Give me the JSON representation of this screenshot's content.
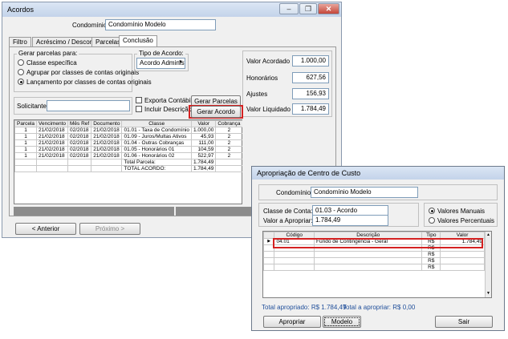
{
  "acordos": {
    "title": "Acordos",
    "condominio_label": "Condomínio:",
    "condominio_value": "Condomínio Modelo",
    "tabs": [
      "Filtro",
      "Acréscimo / Desconto",
      "Parcelas",
      "Conclusão"
    ],
    "gerar_group_title": "Gerar parcelas para:",
    "radio_options": [
      "Classe específica",
      "Agrupar por classes de contas originais",
      "Lançamento por classes de contas originais"
    ],
    "selected_radio": 2,
    "tipo_group_title": "Tipo de Acordo:",
    "tipo_value": "Acordo Administ",
    "valor_acordado_label": "Valor Acordado",
    "valor_acordado": "1.000,00",
    "honorarios_label": "Honorários",
    "honorarios": "627,56",
    "ajustes_label": "Ajustes",
    "ajustes": "156,93",
    "valor_liquido_label": "Valor Liquidado",
    "valor_liquido": "1.784,49",
    "solicitante_label": "Solicitante:",
    "exporta_label": "Exporta Contábil",
    "incluir_label": "Incluir Descrição",
    "gerar_parcelas_btn": "Gerar Parcelas",
    "gerar_acordo_btn": "Gerar Acordo",
    "table": {
      "headers": [
        "Parcela",
        "Vencimento",
        "Mês Ref",
        "Documento",
        "Classe",
        "Valor",
        "Cobrança"
      ],
      "rows": [
        [
          "1",
          "21/02/2018",
          "02/2018",
          "21/02/2018",
          "01.01 - Taxa de Condomínio",
          "1.000,00",
          "2"
        ],
        [
          "1",
          "21/02/2018",
          "02/2018",
          "21/02/2018",
          "01.09 - Juros/Multas Ativos",
          "45,93",
          "2"
        ],
        [
          "1",
          "21/02/2018",
          "02/2018",
          "21/02/2018",
          "01.04 - Outras Cobranças",
          "111,00",
          "2"
        ],
        [
          "1",
          "21/02/2018",
          "02/2018",
          "21/02/2018",
          "01.05 - Honorários 01",
          "104,59",
          "2"
        ],
        [
          "1",
          "21/02/2018",
          "02/2018",
          "21/02/2018",
          "01.06 - Honorários 02",
          "522,97",
          "2"
        ]
      ],
      "total_parcela_label": "Total Parcela:",
      "total_parcela": "1.784,49",
      "total_acordo_label": "TOTAL ACORDO:",
      "total_acordo": "1.784,49"
    },
    "anterior_btn": "< Anterior",
    "proximo_btn": "Próximo >"
  },
  "apropriacao": {
    "title": "Apropriação de Centro de Custo",
    "condominio_label": "Condomínio:",
    "condominio_value": "Condomínio Modelo",
    "classe_label": "Classe de Conta:",
    "classe_value": "01.03 - Acordo",
    "valor_label": "Valor a Apropriar:",
    "valor_value": "1.784,49",
    "radio_manual": "Valores Manuais",
    "radio_percent": "Valores Percentuais",
    "grid_headers": [
      "Código",
      "Descrição",
      "Tipo",
      "Valor"
    ],
    "grid_row": [
      "04.01",
      "Fundo de Contingência - Geral",
      "R$",
      "1.784,49"
    ],
    "empty_tipo": "R$",
    "total_apropriado": "Total apropriado: R$ 1.784,49",
    "total_a_apropriar": "Total a apropriar: R$ 0,00",
    "apropriar_btn": "Apropriar",
    "modelo_btn": "Modelo",
    "sair_btn": "Sair"
  },
  "icons": {
    "minimize": "–",
    "restore": "❐",
    "close": "✕",
    "dropdown": "▼",
    "scroll_up": "▲",
    "scroll_down": "▼",
    "row_pointer": "▶"
  }
}
